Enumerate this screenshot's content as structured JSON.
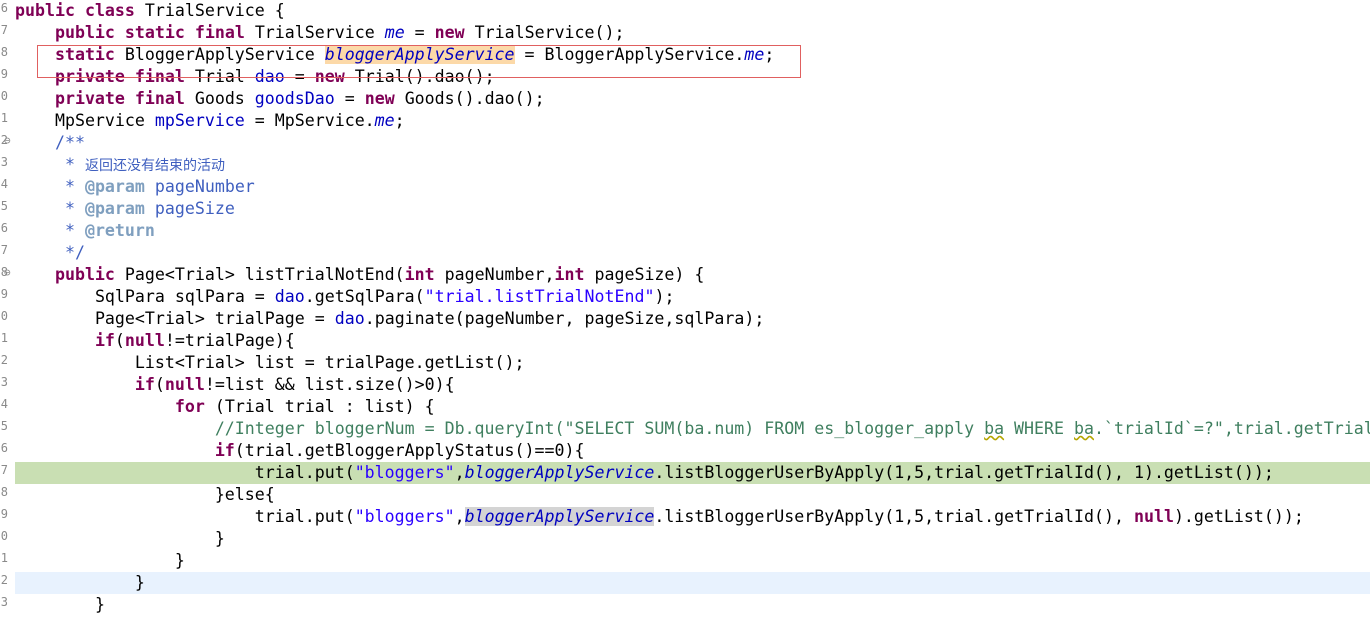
{
  "gutter": {
    "line_numbers": [
      "6",
      "7",
      "8",
      "9",
      "0",
      "1",
      "2",
      "3",
      "4",
      "5",
      "6",
      "7",
      "8",
      "9",
      "0",
      "1",
      "2",
      "3",
      "4",
      "5",
      "6",
      "7",
      "8",
      "9",
      "0",
      "1",
      "2",
      "3"
    ],
    "fold_markers": [
      "⊖",
      "⊖"
    ]
  },
  "code": {
    "l01": {
      "a": "public",
      "b": "class",
      "c": " TrialService {"
    },
    "l02": {
      "a": "public",
      "b": "static",
      "c": "final",
      "d": " TrialService ",
      "e": "me",
      "f": " = ",
      "g": "new",
      "h": " TrialService();"
    },
    "l03": {
      "a": "static",
      "b": " BloggerApplyService ",
      "c": "bloggerApplyService",
      "d": " = BloggerApplyService.",
      "e": "me",
      "f": ";"
    },
    "l04": {
      "a": "private",
      "b": "final",
      "c": " Trial ",
      "d": "dao",
      "e": " = ",
      "f": "new",
      "g": " Trial().dao();"
    },
    "l05": {
      "a": "private",
      "b": "final",
      "c": " Goods ",
      "d": "goodsDao",
      "e": " = ",
      "f": "new",
      "g": " Goods().dao();"
    },
    "l06": {
      "a": "MpService ",
      "b": "mpService",
      "c": " = MpService.",
      "d": "me",
      "e": ";"
    },
    "l07": {
      "a": "/**"
    },
    "l08": {
      "a": " * ",
      "b": "返回还没有结束的活动"
    },
    "l09": {
      "a": " * ",
      "b": "@param",
      "c": " pageNumber"
    },
    "l10": {
      "a": " * ",
      "b": "@param",
      "c": " pageSize"
    },
    "l11": {
      "a": " * ",
      "b": "@return"
    },
    "l12": {
      "a": " */"
    },
    "l13": {
      "a": "public",
      "b": " Page<Trial> listTrialNotEnd(",
      "c": "int",
      "d": " pageNumber,",
      "e": "int",
      "f": " pageSize) {"
    },
    "l14": {
      "a": "SqlPara ",
      "b": "sqlPara",
      "c": " = ",
      "d": "dao",
      "e": ".getSqlPara(",
      "f": "\"trial.listTrialNotEnd\"",
      "g": ");"
    },
    "l15": {
      "a": "Page<Trial> ",
      "b": "trialPage",
      "c": " = ",
      "d": "dao",
      "e": ".paginate(pageNumber, pageSize,sqlPara);"
    },
    "l16": {
      "a": "if",
      "b": "(",
      "c": "null",
      "d": "!=trialPage){"
    },
    "l17": {
      "a": "List<Trial> ",
      "b": "list",
      "c": " = trialPage.getList();"
    },
    "l18": {
      "a": "if",
      "b": "(",
      "c": "null",
      "d": "!=list && list.size()>0){"
    },
    "l19": {
      "a": "for",
      "b": " (Trial ",
      "c": "trial",
      "d": " : list) {"
    },
    "l20": {
      "a": "//Integer bloggerNum = Db.queryInt(\"SELECT SUM(ba.num) FROM es_blogger_apply ",
      "b": "ba",
      "c": " WHERE ",
      "d": "ba",
      "e": ".`trialId`=?\",trial.getTrialId());"
    },
    "l21": {
      "a": "if",
      "b": "(trial.getBloggerApplyStatus()==0){"
    },
    "l22": {
      "a": "trial",
      "b": ".put(",
      "c": "\"bloggers\"",
      "d": ",",
      "e": "bloggerApplyService",
      "f": ".listBloggerUserByApply(1,5,",
      "g": "trial",
      "h": ".getTrialId(), 1).getList());"
    },
    "l23": {
      "a": "}else{"
    },
    "l24": {
      "a": "trial",
      "b": ".put(",
      "c": "\"bloggers\"",
      "d": ",",
      "e": "bloggerApplyService",
      "f": ".listBloggerUserByApply(1,5,",
      "g": "trial",
      "h": ".getTrialId(), ",
      "i": "null",
      "j": ").getList());"
    },
    "l25": {
      "a": "}"
    },
    "l26": {
      "a": "}"
    },
    "l27": {
      "a": "}"
    },
    "l28": {
      "a": "}"
    }
  }
}
